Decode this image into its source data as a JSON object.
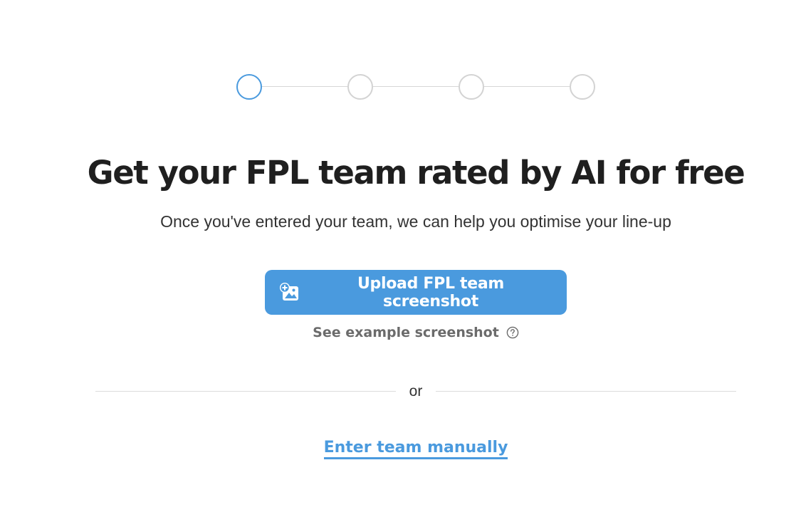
{
  "stepper": {
    "total_steps": 4,
    "current_step": 1
  },
  "header": {
    "title": "Get your FPL team rated by AI for free",
    "subtitle": "Once you've entered your team, we can help you optimise your line-up"
  },
  "upload": {
    "button_label": "Upload FPL team screenshot",
    "icon": "add-image-icon"
  },
  "example": {
    "link_label": "See example screenshot",
    "icon": "help-circle-icon"
  },
  "divider": {
    "label": "or"
  },
  "manual": {
    "link_label": "Enter team manually"
  },
  "colors": {
    "accent": "#4a9ade",
    "step_inactive": "#d3d3d3",
    "heading": "#1f1f1f",
    "muted_link": "#6b6b6b"
  }
}
